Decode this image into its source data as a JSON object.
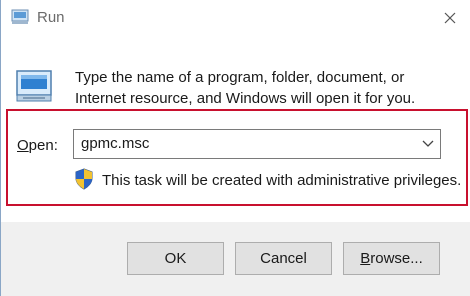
{
  "window": {
    "title": "Run",
    "title_icon": "run-icon",
    "close_icon": "close-icon"
  },
  "description": {
    "line1": "Type the name of a program, folder, document, or",
    "line2": "Internet resource, and Windows will open it for you."
  },
  "open": {
    "label_prefix": "",
    "label_mnemonic": "O",
    "label_rest": "pen:",
    "value": "gpmc.msc",
    "dropdown_icon": "chevron-down-icon"
  },
  "admin_notice": {
    "icon": "uac-shield-icon",
    "text": "This task will be created with administrative privileges."
  },
  "buttons": {
    "ok": "OK",
    "cancel": "Cancel",
    "browse_mnemonic": "B",
    "browse_rest": "rowse..."
  },
  "colors": {
    "highlight_border": "#c8102e",
    "footer_bg": "#f0f0f0",
    "button_bg": "#e1e1e1"
  }
}
